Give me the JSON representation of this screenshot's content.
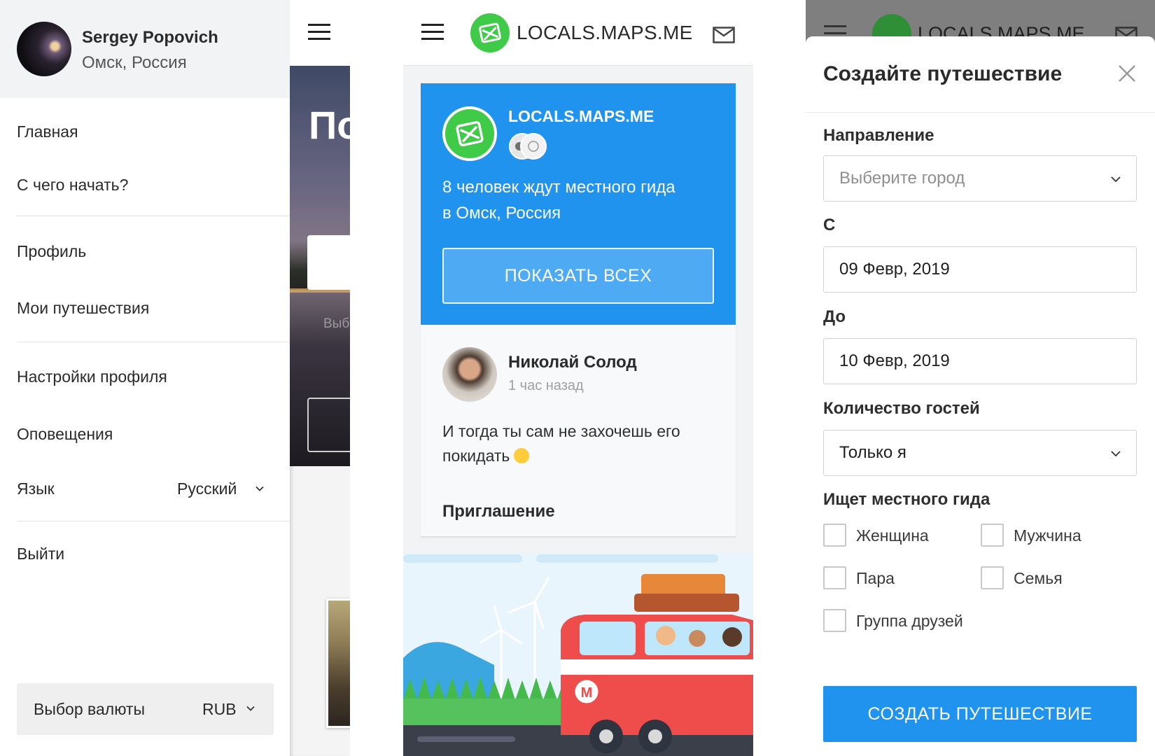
{
  "menu": {
    "user": {
      "name": "Sergey Popovich",
      "city": "Омск, Россия"
    },
    "items": [
      {
        "label": "Главная"
      },
      {
        "label": "С чего начать?"
      },
      {
        "label": "Профиль"
      },
      {
        "label": "Мои путешествия"
      },
      {
        "label": "Настройки профиля"
      },
      {
        "label": "Оповещения"
      },
      {
        "label": "Выйти"
      }
    ],
    "language": {
      "label": "Язык",
      "value": "Русский"
    },
    "currency": {
      "label": "Выбор валюты",
      "value": "RUB"
    }
  },
  "peek": {
    "hero_text": "По",
    "input_text": "Выб"
  },
  "feed": {
    "brand": "LOCALS.MAPS.ME",
    "invite_card": {
      "brand": "LOCALS.MAPS.ME",
      "text_line1": "8 человек ждут местного гида",
      "text_line2": "в Омск, Россия",
      "button": "ПОКАЗАТЬ ВСЕХ"
    },
    "post": {
      "author": "Николай Солод",
      "time": "1 час назад",
      "text": "И тогда ты сам не захочешь его покидать",
      "tag": "Приглашение"
    }
  },
  "modal": {
    "background_brand": "LOCALS.MAPS.ME",
    "title": "Создайте путешествие",
    "direction": {
      "label": "Направление",
      "placeholder": "Выберите город"
    },
    "from": {
      "label": "С",
      "value": "09 Февр, 2019"
    },
    "to": {
      "label": "До",
      "value": "10 Февр, 2019"
    },
    "guests": {
      "label": "Количество гостей",
      "value": "Только я"
    },
    "looking_for": {
      "label": "Ищет местного гида",
      "options": [
        "Женщина",
        "Мужчина",
        "Пара",
        "Семья",
        "Группа друзей"
      ]
    },
    "submit": "СОЗДАТЬ ПУТЕШЕСТВИЕ"
  },
  "colors": {
    "accent_blue": "#1f93ee",
    "brand_green": "#3fca48"
  }
}
